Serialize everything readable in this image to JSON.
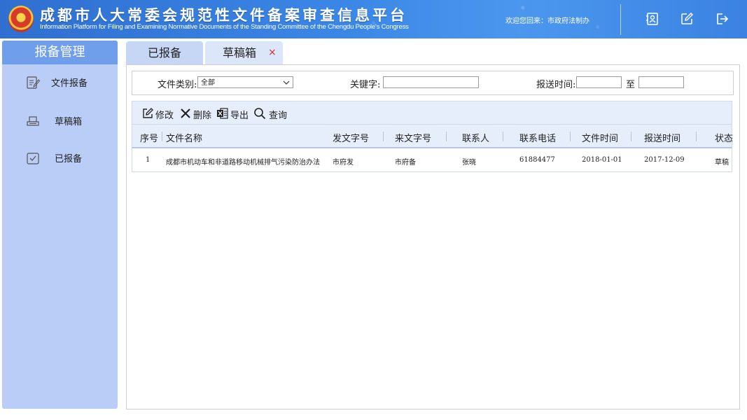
{
  "header": {
    "title_cn": "成都市人大常委会规范性文件备案审查信息平台",
    "title_en": "Information Platform for Filing and Examining Normative Documents of the Standing Committee of the Chengdu People's Congress",
    "welcome": "欢迎您回来：市政府法制办"
  },
  "sidebar": {
    "title": "报备管理",
    "items": [
      {
        "label": "文件报备",
        "icon": "edit-document-icon"
      },
      {
        "label": "草稿箱",
        "icon": "tray-icon"
      },
      {
        "label": "已报备",
        "icon": "checkbox-icon"
      }
    ]
  },
  "tabs": [
    {
      "label": "已报备"
    },
    {
      "label": "草稿箱",
      "close": "×"
    }
  ],
  "filters": {
    "category_label": "文件类别:",
    "category_value": "全部",
    "keyword_label": "关键字:",
    "time_label": "报送时间:",
    "to_label": "至"
  },
  "toolbar": {
    "edit": "修改",
    "delete": "删除",
    "export": "导出",
    "query": "查询"
  },
  "table": {
    "columns": [
      "序号",
      "文件名称",
      "发文字号",
      "来文字号",
      "联系人",
      "联系电话",
      "文件时间",
      "报送时间",
      "状态"
    ],
    "rows": [
      [
        "1",
        "成都市机动车和非道路移动机械排气污染防治办法",
        "市府发",
        "市府备",
        "张晓",
        "61884477",
        "2018-01-01",
        "2017-12-09",
        "草稿"
      ]
    ]
  },
  "colors": {
    "header_blue": "#3a86e6",
    "sidebar_bg": "#b9cdf6",
    "sidebar_head": "#6f9eea",
    "tab_close": "#d92b2b"
  }
}
